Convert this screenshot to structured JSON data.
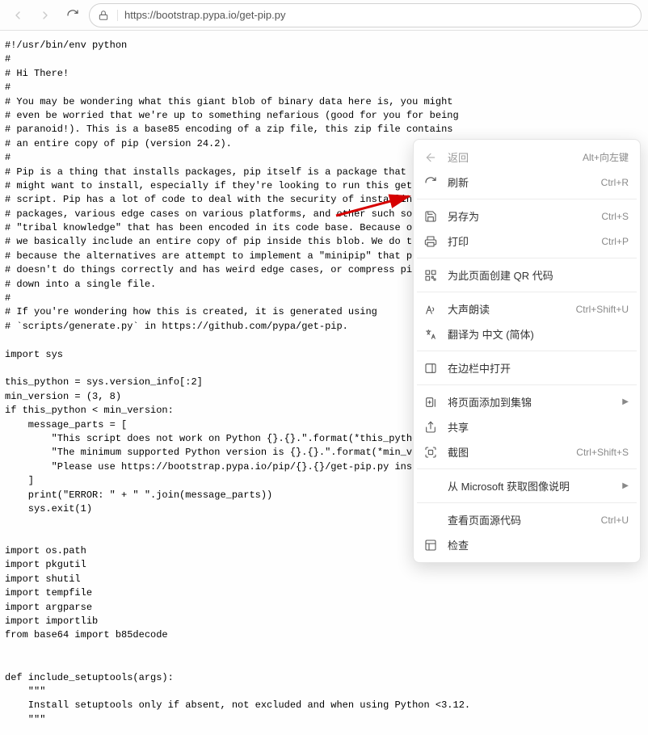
{
  "toolbar": {
    "url": "https://bootstrap.pypa.io/get-pip.py"
  },
  "code": "#!/usr/bin/env python\n#\n# Hi There!\n#\n# You may be wondering what this giant blob of binary data here is, you might\n# even be worried that we're up to something nefarious (good for you for being\n# paranoid!). This is a base85 encoding of a zip file, this zip file contains\n# an entire copy of pip (version 24.2).\n#\n# Pip is a thing that installs packages, pip itself is a package that someone\n# might want to install, especially if they're looking to run this get-pip.py\n# script. Pip has a lot of code to deal with the security of installing\n# packages, various edge cases on various platforms, and other such sort of\n# \"tribal knowledge\" that has been encoded in its code base. Because of this\n# we basically include an entire copy of pip inside this blob. We do this\n# because the alternatives are attempt to implement a \"minipip\" that probably\n# doesn't do things correctly and has weird edge cases, or compress pip itself\n# down into a single file.\n#\n# If you're wondering how this is created, it is generated using\n# `scripts/generate.py` in https://github.com/pypa/get-pip.\n\nimport sys\n\nthis_python = sys.version_info[:2]\nmin_version = (3, 8)\nif this_python < min_version:\n    message_parts = [\n        \"This script does not work on Python {}.{}.\".format(*this_python),\n        \"The minimum supported Python version is {}.{}.\".format(*min_version),\n        \"Please use https://bootstrap.pypa.io/pip/{}.{}/get-pip.py instead.\".format(*this_py\n    ]\n    print(\"ERROR: \" + \" \".join(message_parts))\n    sys.exit(1)\n\n\nimport os.path\nimport pkgutil\nimport shutil\nimport tempfile\nimport argparse\nimport importlib\nfrom base64 import b85decode\n\n\ndef include_setuptools(args):\n    \"\"\"\n    Install setuptools only if absent, not excluded and when using Python <3.12.\n    \"\"\"",
  "menu": {
    "back": {
      "label": "返回",
      "shortcut": "Alt+向左键"
    },
    "refresh": {
      "label": "刷新",
      "shortcut": "Ctrl+R"
    },
    "saveas": {
      "label": "另存为",
      "shortcut": "Ctrl+S"
    },
    "print": {
      "label": "打印",
      "shortcut": "Ctrl+P"
    },
    "qr": {
      "label": "为此页面创建 QR 代码",
      "shortcut": ""
    },
    "readaloud": {
      "label": "大声朗读",
      "shortcut": "Ctrl+Shift+U"
    },
    "translate": {
      "label": "翻译为 中文 (简体)",
      "shortcut": ""
    },
    "sidebar": {
      "label": "在边栏中打开",
      "shortcut": ""
    },
    "collection": {
      "label": "将页面添加到集锦",
      "shortcut": ""
    },
    "share": {
      "label": "共享",
      "shortcut": ""
    },
    "screenshot": {
      "label": "截图",
      "shortcut": "Ctrl+Shift+S"
    },
    "msimage": {
      "label": "从 Microsoft 获取图像说明",
      "shortcut": ""
    },
    "viewsource": {
      "label": "查看页面源代码",
      "shortcut": "Ctrl+U"
    },
    "inspect": {
      "label": "检查",
      "shortcut": ""
    }
  }
}
